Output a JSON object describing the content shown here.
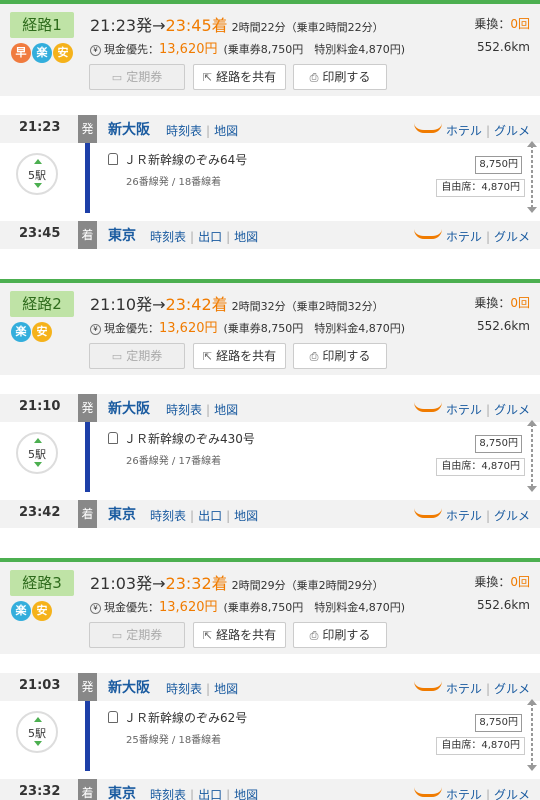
{
  "common": {
    "teiki": "定期券",
    "share": "経路を共有",
    "print": "印刷する",
    "transfer_label": "乗換：",
    "dep_mark": "発",
    "arr_mark": "着",
    "timetable": "時刻表",
    "map": "地図",
    "exit": "出口",
    "hotel": "ホテル",
    "gourmet": "グルメ",
    "reserved_prefix": "自由席："
  },
  "routes": [
    {
      "label": "経路1",
      "badges": [
        "早",
        "楽",
        "安"
      ],
      "dep_time": "21:23発",
      "arrow": "→",
      "arr_time": "23:45着",
      "duration": "2時間22分（乗車2時間22分）",
      "fare_label": "現金優先：",
      "fare": "13,620円",
      "fare_detail": "(乗車券8,750円　特別料金4,870円)",
      "transfers": "0回",
      "distance": "552.6km",
      "from": {
        "time": "21:23",
        "station": "新大阪"
      },
      "to": {
        "time": "23:45",
        "station": "東京"
      },
      "stops": "5駅",
      "train": "ＪＲ新幹線のぞみ64号",
      "tracks": "26番線発 / 18番線着",
      "base_fare": "8,750円",
      "reserved": "4,870円"
    },
    {
      "label": "経路2",
      "badges": [
        "楽",
        "安"
      ],
      "dep_time": "21:10発",
      "arrow": "→",
      "arr_time": "23:42着",
      "duration": "2時間32分（乗車2時間32分）",
      "fare_label": "現金優先：",
      "fare": "13,620円",
      "fare_detail": "(乗車券8,750円　特別料金4,870円)",
      "transfers": "0回",
      "distance": "552.6km",
      "from": {
        "time": "21:10",
        "station": "新大阪"
      },
      "to": {
        "time": "23:42",
        "station": "東京"
      },
      "stops": "5駅",
      "train": "ＪＲ新幹線のぞみ430号",
      "tracks": "26番線発 / 17番線着",
      "base_fare": "8,750円",
      "reserved": "4,870円"
    },
    {
      "label": "経路3",
      "badges": [
        "楽",
        "安"
      ],
      "dep_time": "21:03発",
      "arrow": "→",
      "arr_time": "23:32着",
      "duration": "2時間29分（乗車2時間29分）",
      "fare_label": "現金優先：",
      "fare": "13,620円",
      "fare_detail": "(乗車券8,750円　特別料金4,870円)",
      "transfers": "0回",
      "distance": "552.6km",
      "from": {
        "time": "21:03",
        "station": "新大阪"
      },
      "to": {
        "time": "23:32",
        "station": "東京"
      },
      "stops": "5駅",
      "train": "ＪＲ新幹線のぞみ62号",
      "tracks": "25番線発 / 18番線着",
      "base_fare": "8,750円",
      "reserved": "4,870円"
    }
  ]
}
